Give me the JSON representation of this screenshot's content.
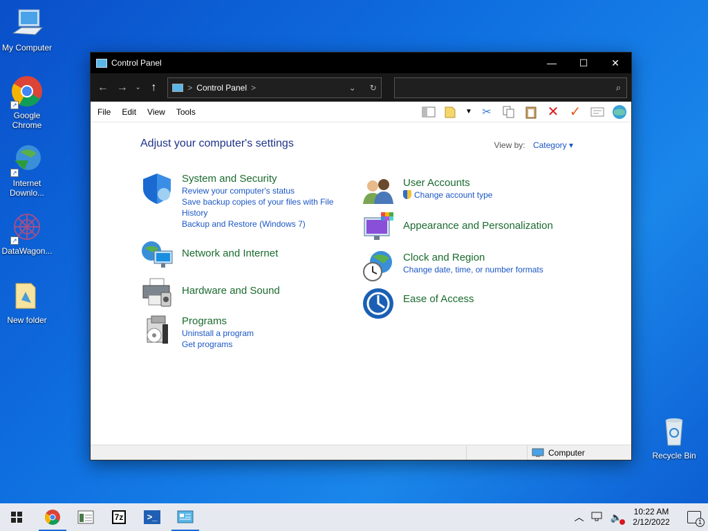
{
  "desktop": {
    "icons": [
      {
        "label": "My Computer"
      },
      {
        "label": "Google Chrome"
      },
      {
        "label": "Internet Downlo..."
      },
      {
        "label": "DataWagon..."
      },
      {
        "label": "New folder"
      },
      {
        "label": "Recycle Bin"
      }
    ]
  },
  "window": {
    "title": "Control Panel",
    "address": {
      "root_sep": ">",
      "path": "Control Panel",
      "trail_sep": ">"
    },
    "menu": [
      "File",
      "Edit",
      "View",
      "Tools"
    ],
    "heading": "Adjust your computer's settings",
    "view_by_label": "View by:",
    "view_by_value": "Category",
    "left_items": [
      {
        "title": "System and Security",
        "links": [
          "Review your computer's status",
          "Save backup copies of your files with File History",
          "Backup and Restore (Windows 7)"
        ]
      },
      {
        "title": "Network and Internet",
        "links": []
      },
      {
        "title": "Hardware and Sound",
        "links": []
      },
      {
        "title": "Programs",
        "links": [
          "Uninstall a program",
          "Get programs"
        ]
      }
    ],
    "right_items": [
      {
        "title": "User Accounts",
        "links": [
          "Change account type"
        ]
      },
      {
        "title": "Appearance and Personalization",
        "links": []
      },
      {
        "title": "Clock and Region",
        "links": [
          "Change date, time, or number formats"
        ]
      },
      {
        "title": "Ease of Access",
        "links": []
      }
    ],
    "status_location": "Computer"
  },
  "taskbar": {
    "time": "10:22 AM",
    "date": "2/12/2022",
    "notifications": "1"
  },
  "colors": {
    "category_title": "#1b6b2e",
    "link": "#1a56c4",
    "heading": "#1e3287"
  }
}
